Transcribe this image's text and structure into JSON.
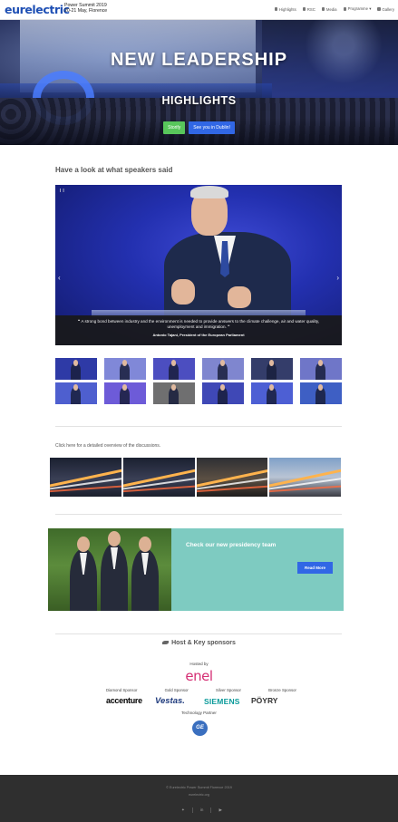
{
  "header": {
    "logo": "eurelectric",
    "event_line1": "Power Summit 2019",
    "event_line2": "20-21 May, Florence",
    "nav": [
      "Highlights",
      "RSC",
      "Media",
      "Programme ▾",
      "Gallery"
    ]
  },
  "hero": {
    "title": "NEW LEADERSHIP",
    "subtitle": "HIGHLIGHTS",
    "btn_story": "Storify",
    "btn_dublin": "See you in Dublin!"
  },
  "speakers": {
    "title": "Have a look at what speakers said",
    "quote": "❝ A strong bond between industry and the environment is needed to provide answers to the climate challenge, air and water quality, unemployment and immigration. ❞",
    "author": "Antonio Tajani, President of the European Parliament",
    "thumb_colors": [
      "#2e3aa6",
      "#8088d8",
      "#4c4ec0",
      "#7f86cf",
      "#343d6a",
      "#6f76c8",
      "#4e5fcf",
      "#6d5bd8",
      "#6f6f70",
      "#3f48b6",
      "#4d5fd4",
      "#3e5fc4"
    ]
  },
  "discussions": {
    "text": "Click here for a detailed overview of the discussions."
  },
  "presidency": {
    "title": "Check our new presidency team",
    "button": "Read More"
  },
  "sponsors": {
    "title": "Host & Key sponsors",
    "hosted_by": "Hosted by",
    "host_logo": "enel",
    "categories": [
      "Diamond Sponsor",
      "Gold Sponsor",
      "Silver Sponsor",
      "Bronze Sponsor"
    ],
    "logos": [
      "accenture",
      "Vestas.",
      "SIEMENS",
      "PÖYRY"
    ],
    "tech_label": "Technology Partner",
    "tech_logo": "GE"
  },
  "footer": {
    "copyright": "© Eurelectric Power Summit Florence 2019",
    "site": "eurelectric.org"
  },
  "colors": {
    "brand_blue": "#1e4fb4",
    "accent_blue": "#3167e5",
    "accent_green": "#58c65b",
    "teal_panel": "#7ecbc1",
    "footer_bg": "#2f2f2f"
  }
}
